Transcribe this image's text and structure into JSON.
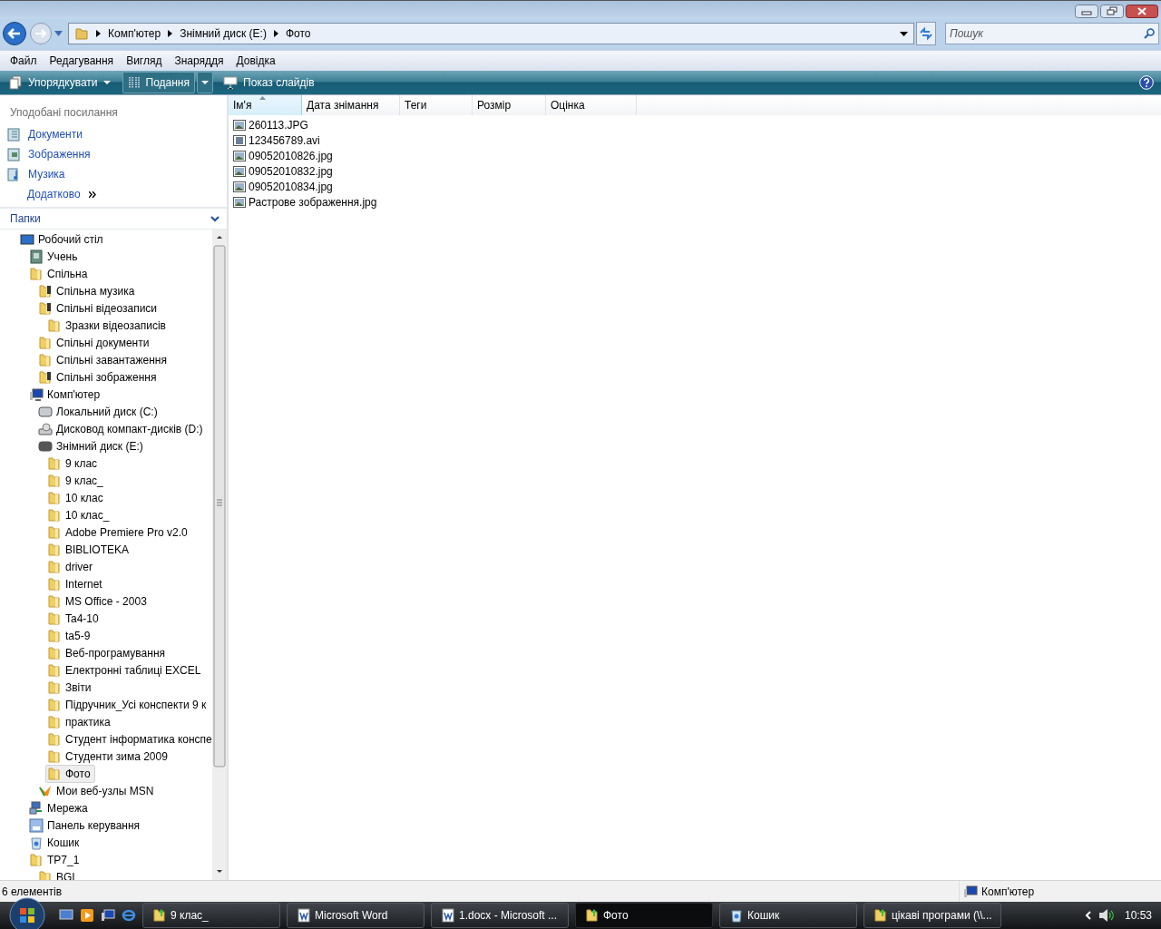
{
  "address_bar": {
    "crumbs": [
      "Комп'ютер",
      "Знімний диск (E:)",
      "Фото"
    ]
  },
  "search": {
    "placeholder": "Пошук"
  },
  "menu": [
    "Файл",
    "Редагування",
    "Вигляд",
    "Знаряддя",
    "Довідка"
  ],
  "toolbar": {
    "organize": "Упорядкувати",
    "views": "Подання",
    "slideshow": "Показ слайдів"
  },
  "favorites": {
    "title": "Уподобані посилання",
    "items": [
      {
        "label": "Документи",
        "kind": "documents"
      },
      {
        "label": "Зображення",
        "kind": "pictures"
      },
      {
        "label": "Музика",
        "kind": "music"
      },
      {
        "label": "Додатково",
        "kind": "more"
      }
    ]
  },
  "folders": {
    "title": "Папки",
    "items": [
      {
        "label": "Робочий стіл",
        "kind": "desktop",
        "selected": false,
        "children": [
          {
            "label": "Учень",
            "kind": "user",
            "selected": false
          },
          {
            "label": "Спільна",
            "kind": "folder",
            "selected": false,
            "children": [
              {
                "label": "Спільна музика",
                "kind": "media-folder",
                "selected": false
              },
              {
                "label": "Спільні відеозаписи",
                "kind": "media-folder",
                "selected": false,
                "children": [
                  {
                    "label": "Зразки відеозаписів",
                    "kind": "folder",
                    "selected": false
                  }
                ]
              },
              {
                "label": "Спільні документи",
                "kind": "folder",
                "selected": false
              },
              {
                "label": "Спільні завантаження",
                "kind": "folder",
                "selected": false
              },
              {
                "label": "Спільні зображення",
                "kind": "media-folder",
                "selected": false
              }
            ]
          },
          {
            "label": "Комп'ютер",
            "kind": "computer",
            "selected": false,
            "children": [
              {
                "label": "Локальний диск (C:)",
                "kind": "drive",
                "selected": false
              },
              {
                "label": "Дисковод компакт-дисків (D:)",
                "kind": "cdrom",
                "selected": false
              },
              {
                "label": "Знімний диск (E:)",
                "kind": "removable",
                "selected": false,
                "children": [
                  {
                    "label": "9 клас",
                    "kind": "folder",
                    "selected": false
                  },
                  {
                    "label": "9 клас_",
                    "kind": "folder",
                    "selected": false
                  },
                  {
                    "label": "10 клас",
                    "kind": "folder",
                    "selected": false
                  },
                  {
                    "label": "10 клас_",
                    "kind": "folder",
                    "selected": false
                  },
                  {
                    "label": "Adobe Premiere Pro v2.0",
                    "kind": "folder",
                    "selected": false
                  },
                  {
                    "label": "BIBLIOTEKA",
                    "kind": "folder",
                    "selected": false
                  },
                  {
                    "label": "driver",
                    "kind": "folder",
                    "selected": false
                  },
                  {
                    "label": "Internet",
                    "kind": "folder",
                    "selected": false
                  },
                  {
                    "label": "MS Office - 2003",
                    "kind": "folder",
                    "selected": false
                  },
                  {
                    "label": "Ta4-10",
                    "kind": "folder",
                    "selected": false
                  },
                  {
                    "label": "ta5-9",
                    "kind": "folder",
                    "selected": false
                  },
                  {
                    "label": "Веб-програмування",
                    "kind": "folder",
                    "selected": false
                  },
                  {
                    "label": "Електронні таблиці EXCEL",
                    "kind": "folder",
                    "selected": false
                  },
                  {
                    "label": "Звіти",
                    "kind": "folder",
                    "selected": false
                  },
                  {
                    "label": "Підручник_Усі конспекти 9 к",
                    "kind": "folder",
                    "selected": false
                  },
                  {
                    "label": "практика",
                    "kind": "folder",
                    "selected": false
                  },
                  {
                    "label": "Студент інформатика конспе",
                    "kind": "folder",
                    "selected": false
                  },
                  {
                    "label": "Студенти зима 2009",
                    "kind": "folder",
                    "selected": false
                  },
                  {
                    "label": "Фото",
                    "kind": "folder",
                    "selected": true
                  }
                ]
              },
              {
                "label": "Мои веб-узлы MSN",
                "kind": "msn",
                "selected": false
              }
            ]
          },
          {
            "label": "Мережа",
            "kind": "network",
            "selected": false
          },
          {
            "label": "Панель керування",
            "kind": "control",
            "selected": false
          },
          {
            "label": "Кошик",
            "kind": "trash",
            "selected": false
          },
          {
            "label": "TP7_1",
            "kind": "folder",
            "selected": false,
            "children": [
              {
                "label": "BGI",
                "kind": "folder",
                "selected": false
              }
            ]
          }
        ]
      }
    ]
  },
  "columns": [
    {
      "label": "Ім'я",
      "sorted": true
    },
    {
      "label": "Дата знімання",
      "sorted": false
    },
    {
      "label": "Теги",
      "sorted": false
    },
    {
      "label": "Розмір",
      "sorted": false
    },
    {
      "label": "Оцінка",
      "sorted": false
    }
  ],
  "files": [
    {
      "name": "260113.JPG",
      "kind": "image"
    },
    {
      "name": "123456789.avi",
      "kind": "video"
    },
    {
      "name": "09052010826.jpg",
      "kind": "image"
    },
    {
      "name": "09052010832.jpg",
      "kind": "image"
    },
    {
      "name": "09052010834.jpg",
      "kind": "image"
    },
    {
      "name": "Растрове зображення.jpg",
      "kind": "image"
    }
  ],
  "status_bar": {
    "count": "6 елементів",
    "location": "Комп'ютер"
  },
  "taskbar": {
    "buttons": [
      {
        "label": "9 клас_",
        "kind": "folder",
        "selected": false
      },
      {
        "label": "Microsoft Word",
        "kind": "word",
        "selected": false
      },
      {
        "label": "1.docx - Microsoft ...",
        "kind": "word",
        "selected": false
      },
      {
        "label": "Фото",
        "kind": "folder",
        "selected": true
      },
      {
        "label": "Кошик",
        "kind": "trash",
        "selected": false
      },
      {
        "label": "цікаві програми (\\\\...",
        "kind": "folder",
        "selected": false
      }
    ],
    "clock": "10:53"
  }
}
